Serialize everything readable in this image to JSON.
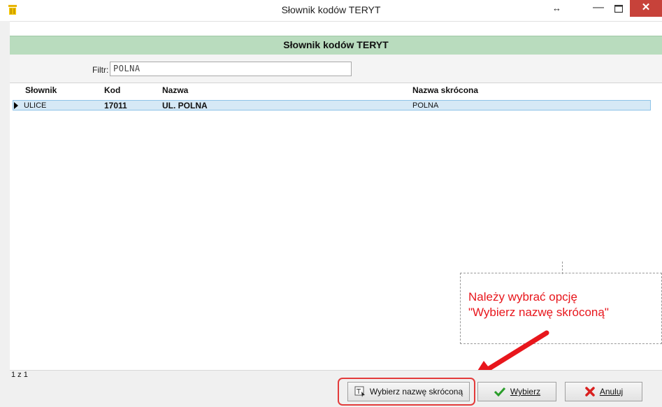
{
  "window": {
    "title": "Słownik kodów TERYT",
    "resize_glyph": "↔",
    "minimize_glyph": "—",
    "close_glyph": "✕",
    "accent_close": "#c7423a"
  },
  "header": {
    "title": "Słownik kodów TERYT",
    "color": "#b9dcbe"
  },
  "filter": {
    "label": "Filtr:",
    "value": "POLNA"
  },
  "grid": {
    "columns": [
      "Słownik",
      "Kod",
      "Nazwa",
      "Nazwa skrócona"
    ],
    "rows": [
      {
        "slownik": "ULICE",
        "kod": "17011",
        "nazwa": "UL. POLNA",
        "nazwa_skrocona": "POLNA",
        "selected": true
      }
    ]
  },
  "status": {
    "text": "1 z 1"
  },
  "buttons": {
    "shortname": {
      "label": "Wybierz nazwę skróconą",
      "icon": "text-select-icon"
    },
    "select": {
      "label": "Wybierz",
      "icon": "checkmark-icon"
    },
    "cancel": {
      "label": "Anuluj",
      "icon": "red-x-icon"
    }
  },
  "annotation": {
    "line1": "Należy wybrać opcję",
    "line2": "\"Wybierz nazwę skróconą\"",
    "color": "#e8161c"
  }
}
